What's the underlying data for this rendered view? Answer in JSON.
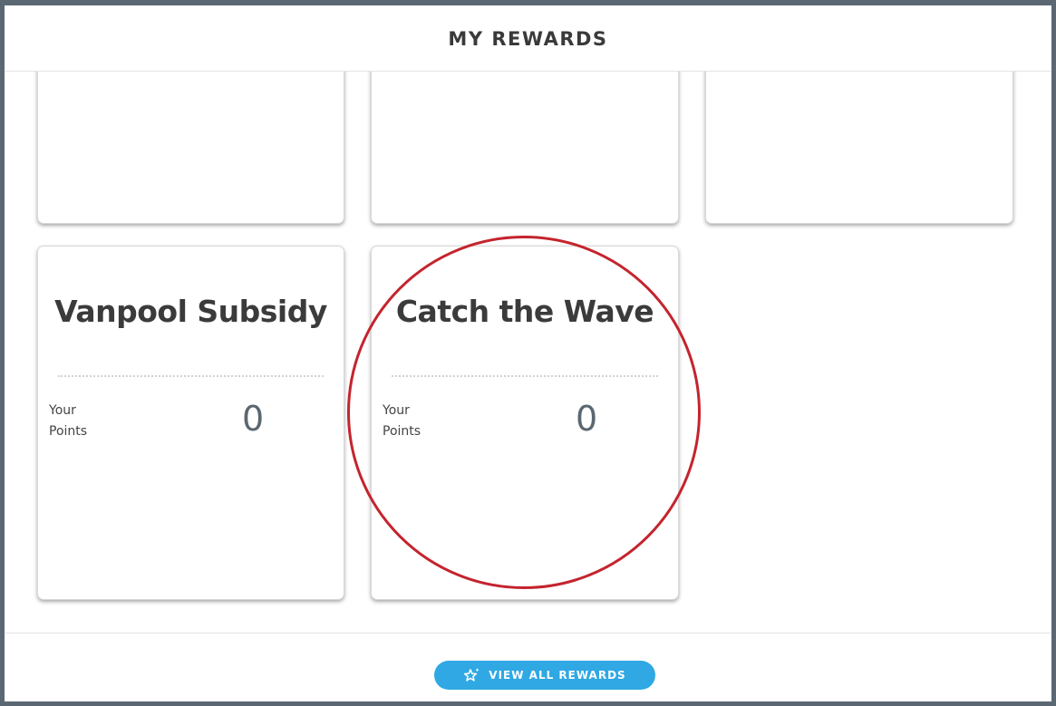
{
  "header": {
    "title": "MY REWARDS"
  },
  "rewards": [
    {
      "title": "Vanpool Subsidy",
      "points_label": "Your Points",
      "points_label_line1": "Your",
      "points_label_line2": "Points",
      "points": "0"
    },
    {
      "title": "Catch the Wave",
      "points_label": "Your Points",
      "points_label_line1": "Your",
      "points_label_line2": "Points",
      "points": "0"
    }
  ],
  "footer": {
    "view_all_label": "VIEW ALL REWARDS",
    "view_all_icon": "star-sparkle-icon"
  },
  "colors": {
    "frame_border": "#5b6773",
    "button_bg": "#2fa8e4",
    "highlight_circle": "#c4242e",
    "title_text": "#3b3b3b",
    "points_value": "#5b6770"
  }
}
